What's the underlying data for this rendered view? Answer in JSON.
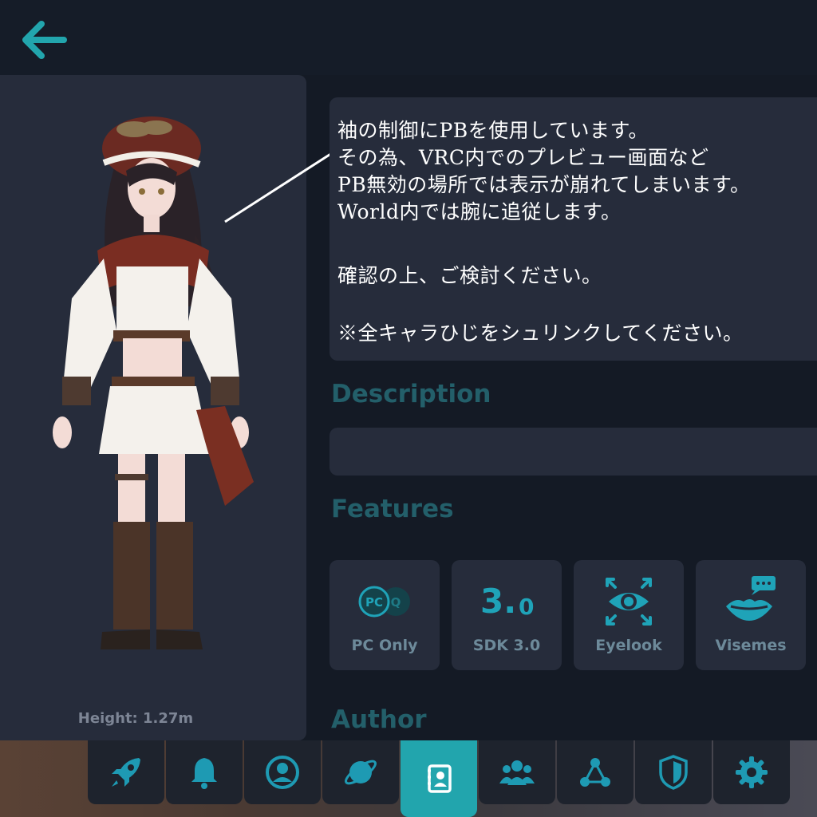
{
  "colors": {
    "accent": "#22a5ad",
    "accent_text": "#235f6a",
    "panel": "#262c3b",
    "background": "#141a25",
    "icon": "#1fa3b8",
    "nav_icon": "#1e9ab3"
  },
  "header": {
    "back_icon": "arrow-left-icon"
  },
  "avatar_preview": {
    "height_label": "Height: 1.27m"
  },
  "note": {
    "lines": [
      "袖の制御にPBを使用しています。",
      "その為、VRC内でのプレビュー画面など",
      "PB無効の場所では表示が崩れてしまいます。",
      "World内では腕に追従します。",
      "",
      "確認の上、ご検討ください。",
      "",
      "※全キャラひじをシュリンクしてください。"
    ]
  },
  "sections": {
    "description_title": "Description",
    "description_text": "",
    "features_title": "Features",
    "author_title": "Author"
  },
  "features": [
    {
      "label": "PC Only",
      "icon": "pc-quest-icon",
      "badge_pc": "PC",
      "badge_q": "Q"
    },
    {
      "label": "SDK 3.0",
      "icon": "sdk-version-icon",
      "big": "3.",
      "small": "0"
    },
    {
      "label": "Eyelook",
      "icon": "eye-tracking-icon"
    },
    {
      "label": "Visemes",
      "icon": "lips-speech-icon"
    }
  ],
  "nav": {
    "items": [
      {
        "icon": "rocket-icon",
        "active": false
      },
      {
        "icon": "bell-icon",
        "active": false
      },
      {
        "icon": "profile-icon",
        "active": false
      },
      {
        "icon": "planet-icon",
        "active": false
      },
      {
        "icon": "avatar-book-icon",
        "active": true
      },
      {
        "icon": "social-group-icon",
        "active": false
      },
      {
        "icon": "network-icon",
        "active": false
      },
      {
        "icon": "shield-icon",
        "active": false
      },
      {
        "icon": "gear-icon",
        "active": false
      }
    ]
  }
}
